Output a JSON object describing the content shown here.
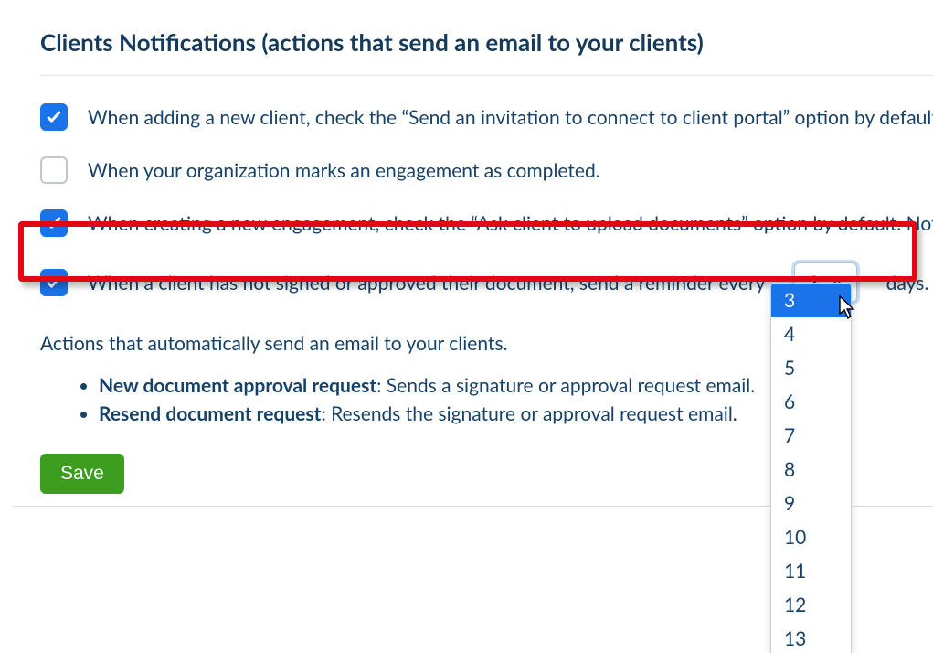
{
  "section_title": "Clients Notifications (actions that send an email to your clients)",
  "options": [
    {
      "checked": true,
      "label": "When adding a new client, check the “Send an invitation to connect to client portal” option by default."
    },
    {
      "checked": false,
      "label": "When your organization marks an engagement as completed."
    },
    {
      "checked": true,
      "label": "When creating a new engagement, check the “Ask client to upload documents” option by default. Note"
    },
    {
      "checked": true,
      "label_before": "When a client has not signed or approved their document, send a reminder every",
      "label_after": "days."
    }
  ],
  "reminder": {
    "selected": "3",
    "options": [
      "3",
      "4",
      "5",
      "6",
      "7",
      "8",
      "9",
      "10",
      "11",
      "12",
      "13"
    ]
  },
  "sub_text": "Actions that automatically send an email to your clients.",
  "bullets": [
    {
      "bold": "New document approval request",
      "rest": ": Sends a signature or approval request email."
    },
    {
      "bold": "Resend document request",
      "rest": ": Resends the signature or approval request email."
    }
  ],
  "save_label": "Save"
}
